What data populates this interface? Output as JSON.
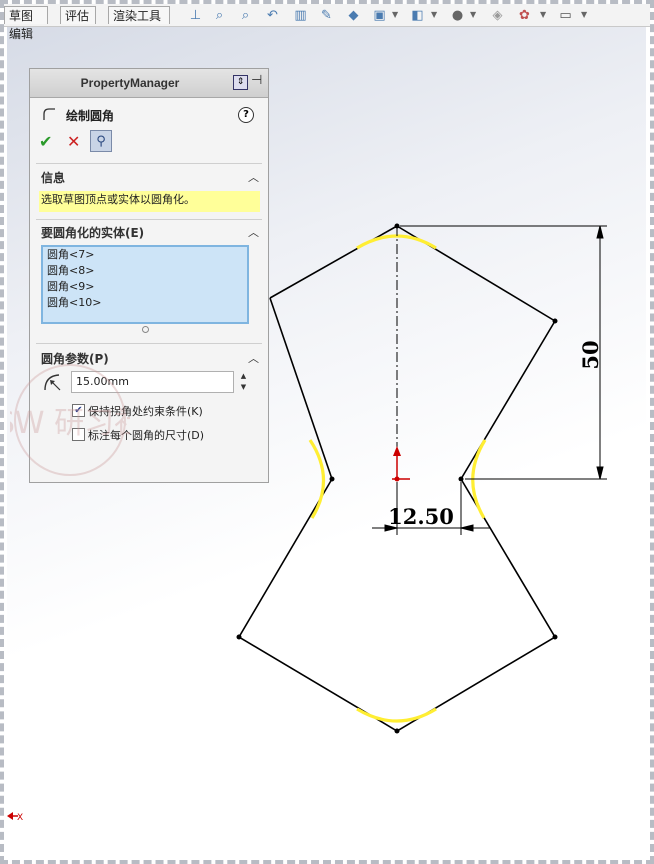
{
  "toolbar": {
    "tabs": [
      "草图编辑",
      "评估",
      "渲染工具"
    ],
    "icons": [
      "view-orientation-icon",
      "zoom-fit-icon",
      "zoom-area-icon",
      "previous-view-icon",
      "section-view-icon",
      "dynamic-annotation-icon",
      "view-cube-icon",
      "display-style-icon",
      "hide-show-icon",
      "appearance-icon",
      "scene-icon",
      "monitor-icon"
    ]
  },
  "property_manager": {
    "header": "PropertyManager",
    "command_title": "绘制圆角",
    "info_section": {
      "title": "信息",
      "message": "选取草图顶点或实体以圆角化。"
    },
    "entities_section": {
      "title": "要圆角化的实体(E)",
      "items": [
        "圆角<7>",
        "圆角<8>",
        "圆角<9>",
        "圆角<10>"
      ]
    },
    "params_section": {
      "title": "圆角参数(P)",
      "radius_value": "15.00mm",
      "keep_corner_label": "保持拐角处约束条件(K)",
      "keep_corner_checked": true,
      "dimension_each_label": "标注每个圆角的尺寸(D)",
      "dimension_each_checked": false
    }
  },
  "sketch": {
    "dimension_vertical": "50",
    "dimension_horizontal": "12.50",
    "fillet_color": "#ffee33",
    "origin_color": "#cc0000"
  },
  "watermark": {
    "text": "SW 研习社"
  },
  "status": {
    "axis_label": "X"
  }
}
